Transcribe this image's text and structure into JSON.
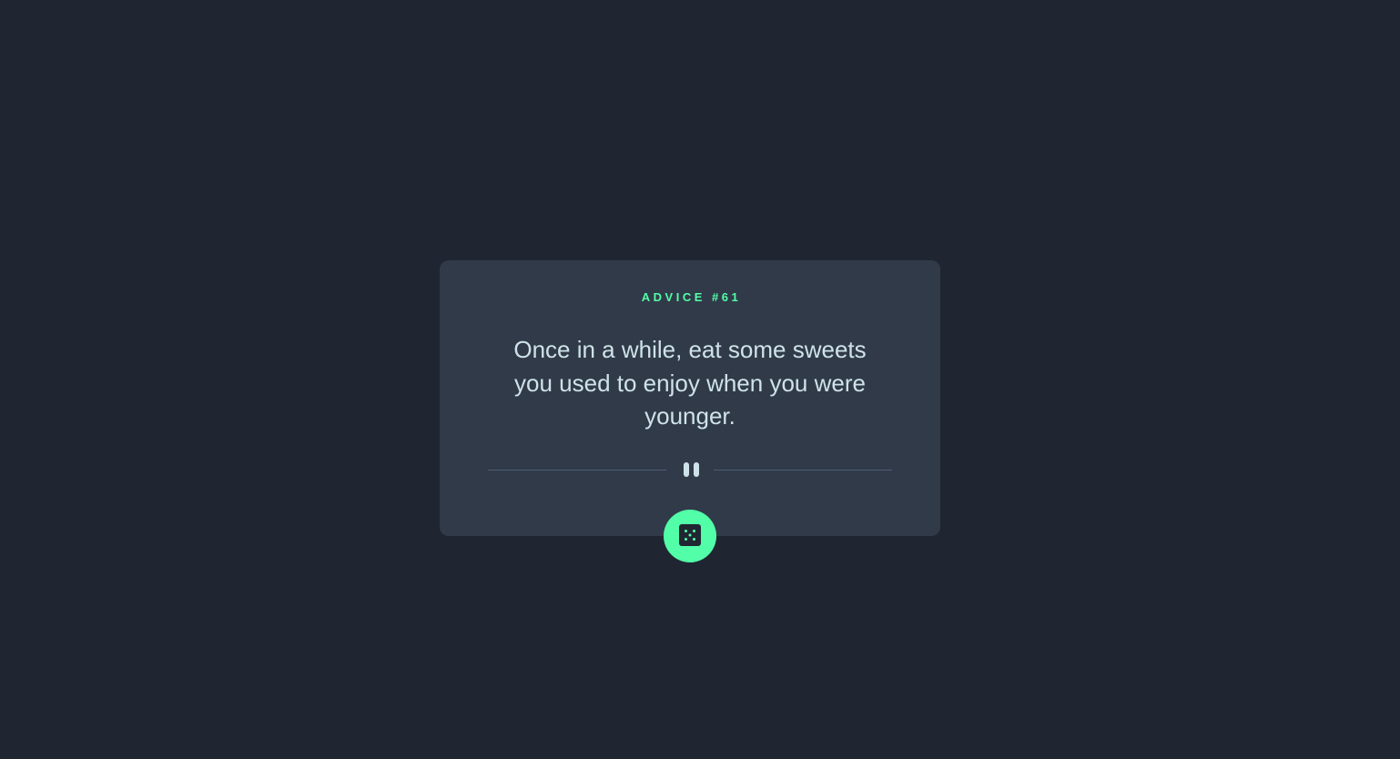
{
  "advice": {
    "heading": "ADVICE #61",
    "text": "Once in a while, eat some sweets you used to enjoy when you were younger."
  },
  "colors": {
    "background": "#1f2632",
    "card": "#313a49",
    "accent": "#52ffa8",
    "text": "#cee3e9",
    "divider": "#4f5d74"
  },
  "icons": {
    "divider": "pause-icon",
    "button": "dice-icon"
  }
}
